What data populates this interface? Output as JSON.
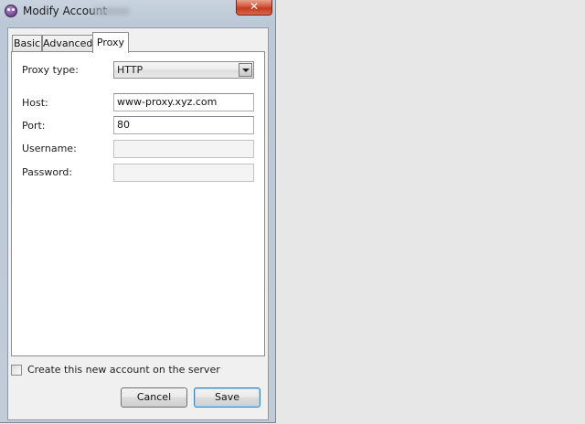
{
  "window": {
    "title": "Modify Account",
    "close_glyph": "✕"
  },
  "tabs": [
    {
      "label": "Basic",
      "active": false
    },
    {
      "label": "Advanced",
      "active": false
    },
    {
      "label": "Proxy",
      "active": true
    }
  ],
  "proxy": {
    "type_label": "Proxy type:",
    "type_value": "HTTP",
    "host_label": "Host:",
    "host_value": "www-proxy.xyz.com",
    "port_label": "Port:",
    "port_value": "80",
    "username_label": "Username:",
    "username_value": "",
    "password_label": "Password:",
    "password_value": ""
  },
  "create_account": {
    "label": "Create this new account on the server",
    "checked": false
  },
  "buttons": {
    "cancel": "Cancel",
    "save": "Save"
  },
  "icons": {
    "app": "pidgin-app-icon",
    "close": "close-icon",
    "dropdown": "chevron-down-icon"
  },
  "colors": {
    "window_frame": "#c2ccd8",
    "close_button": "#c43b1f",
    "default_button_border": "#3c7fb1"
  }
}
